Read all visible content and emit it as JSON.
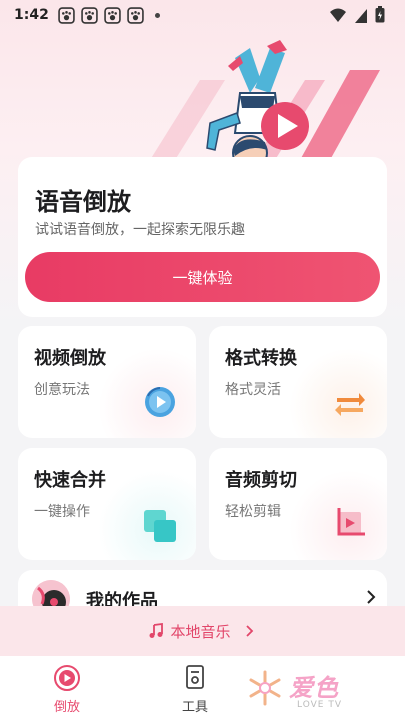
{
  "status_bar": {
    "time": "1:42"
  },
  "main_card": {
    "title": "语音倒放",
    "subtitle": "试试语音倒放，一起探索无限乐趣",
    "button_label": "一键体验"
  },
  "tiles": [
    {
      "title": "视频倒放",
      "subtitle": "创意玩法",
      "icon": "rewind-icon"
    },
    {
      "title": "格式转换",
      "subtitle": "格式灵活",
      "icon": "swap-arrows-icon"
    },
    {
      "title": "快速合并",
      "subtitle": "一键操作",
      "icon": "merge-squares-icon"
    },
    {
      "title": "音频剪切",
      "subtitle": "轻松剪辑",
      "icon": "crop-play-icon"
    }
  ],
  "works": {
    "title": "我的作品"
  },
  "local_music": {
    "label": "本地音乐"
  },
  "bottom_nav": {
    "items": [
      {
        "label": "倒放",
        "active": true
      },
      {
        "label": "工具",
        "active": false
      }
    ]
  },
  "watermark": {
    "text": "爱色",
    "sub": "LOVE TV"
  },
  "colors": {
    "accent": "#e83b64",
    "tile_blue": "#4aa3e0",
    "tile_orange": "#f08a3c",
    "tile_teal": "#37c6c6"
  }
}
